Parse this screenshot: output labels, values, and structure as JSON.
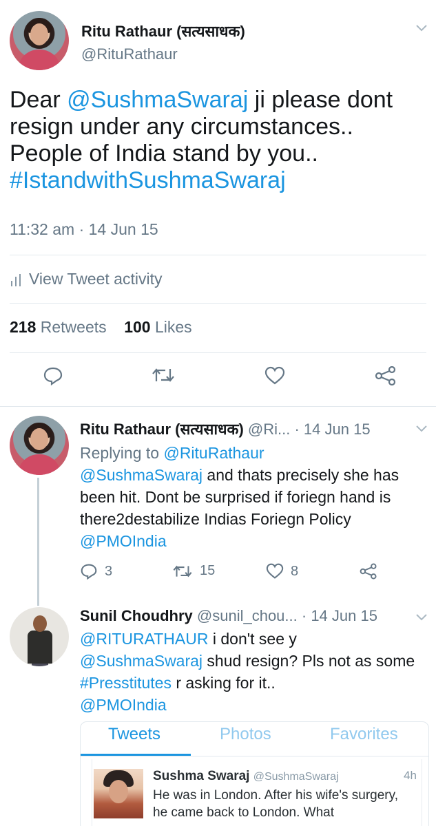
{
  "main_tweet": {
    "author_name": "Ritu Rathaur (सत्यसाधक)",
    "author_handle": "@RituRathaur",
    "text_parts": {
      "t1": "Dear ",
      "m1": "@SushmaSwaraj",
      "t2": " ji please dont resign under any circumstances.. People of India stand by you.. ",
      "h1": "#IstandwithSushmaSwaraj"
    },
    "timestamp": "11:32 am · 14 Jun 15",
    "activity_label": "View Tweet activity",
    "retweets_count": "218",
    "retweets_label": "Retweets",
    "likes_count": "100",
    "likes_label": "Likes"
  },
  "replies": [
    {
      "author_name": "Ritu Rathaur (सत्यसाधक)",
      "author_handle": "@Ri...",
      "date": "· 14 Jun 15",
      "replying_prefix": "Replying to ",
      "replying_to": "@RituRathaur",
      "m1": "@SushmaSwaraj",
      "text": " and thats precisely she has been hit. Dont be surprised if foriegn hand is there2destabilize Indias Foriegn Policy",
      "m2": "@PMOIndia",
      "reply_count": "3",
      "retweet_count": "15",
      "like_count": "8"
    },
    {
      "author_name": "Sunil Choudhry",
      "author_handle": "@sunil_chou...",
      "date": "· 14 Jun 15",
      "m1": "@RITURATHAUR",
      "t1": " i don't see y",
      "m2": "@SushmaSwaraj",
      "t2": " shud resign? Pls not as some ",
      "h1": "#Presstitutes",
      "t3": " r asking for it..",
      "m3": "@PMOIndia"
    }
  ],
  "embed": {
    "tabs": [
      "Tweets",
      "Photos",
      "Favorites"
    ],
    "active_tab": "Tweets",
    "tweet_author": "Sushma Swaraj",
    "tweet_handle": "@SushmaSwaraj",
    "tweet_time": "4h",
    "tweet_text": "He was in London. After his wife's surgery, he came back to London. What"
  },
  "colors": {
    "link": "#1b95e0",
    "secondary_text": "#657786",
    "divider": "#e1e8ed"
  }
}
